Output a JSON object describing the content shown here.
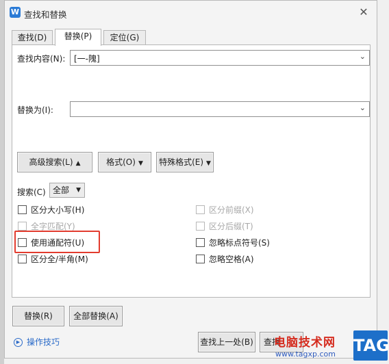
{
  "window": {
    "title": "查找和替换",
    "close_glyph": "✕",
    "app_icon_letter": "W"
  },
  "tabs": [
    {
      "label": "查找(D)"
    },
    {
      "label": "替换(P)"
    },
    {
      "label": "定位(G)"
    }
  ],
  "find": {
    "label": "查找内容(N):",
    "value": "[一-隗]"
  },
  "replace": {
    "label": "替换为(I):",
    "value": ""
  },
  "buttons": {
    "advanced": "高级搜索(L)",
    "format": "格式(O)",
    "special": "特殊格式(E)",
    "replace": "替换(R)",
    "replace_all": "全部替换(A)",
    "find_prev": "查找上一处(B)",
    "find_next": "查找"
  },
  "search": {
    "label": "搜索(C)",
    "value": "全部"
  },
  "options_left": [
    {
      "label": "区分大小写(H)",
      "checked": false,
      "disabled": false
    },
    {
      "label": "全字匹配(Y)",
      "checked": false,
      "disabled": true
    },
    {
      "label": "使用通配符(U)",
      "checked": false,
      "disabled": false
    },
    {
      "label": "区分全/半角(M)",
      "checked": false,
      "disabled": false
    }
  ],
  "options_right": [
    {
      "label": "区分前缀(X)",
      "checked": false,
      "disabled": true
    },
    {
      "label": "区分后缀(T)",
      "checked": false,
      "disabled": true
    },
    {
      "label": "忽略标点符号(S)",
      "checked": false,
      "disabled": false
    },
    {
      "label": "忽略空格(A)",
      "checked": false,
      "disabled": false
    }
  ],
  "tips": {
    "label": "操作技巧"
  },
  "watermark": {
    "title": "电脑技术网",
    "url": "www.tagxp.com",
    "badge": "TAG"
  }
}
